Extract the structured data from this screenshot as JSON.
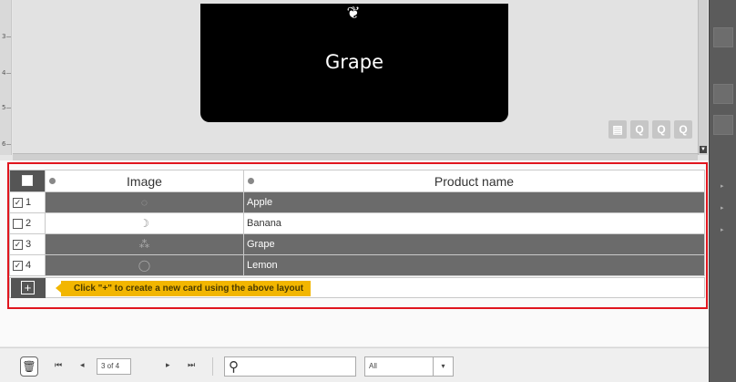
{
  "ruler": {
    "ticks": [
      "3",
      "4",
      "5",
      "6"
    ]
  },
  "card": {
    "logo": "❦",
    "title": "Grape"
  },
  "zoom": {
    "print_icon": "print-icon",
    "zoom_fit_icon": "zoom-fit-icon",
    "zoom_in_icon": "zoom-in-icon",
    "zoom_out_icon": "zoom-out-icon"
  },
  "grid": {
    "columns": [
      "Image",
      "Product name"
    ],
    "rows": [
      {
        "index": "1",
        "checked": true,
        "name": "Apple",
        "icon": "apple-icon"
      },
      {
        "index": "2",
        "checked": false,
        "name": "Banana",
        "icon": "banana-icon"
      },
      {
        "index": "3",
        "checked": true,
        "name": "Grape",
        "icon": "grape-icon"
      },
      {
        "index": "4",
        "checked": true,
        "name": "Lemon",
        "icon": "lemon-icon"
      }
    ],
    "add_tip": "Click \"+\" to create a new card using the above layout"
  },
  "toolbar": {
    "page": "3 of 4",
    "search_placeholder": "",
    "filter_value": "All"
  },
  "colors": {
    "highlight": "#e0151e",
    "tip": "#f2b600",
    "row_dark": "#6b6b6b"
  }
}
